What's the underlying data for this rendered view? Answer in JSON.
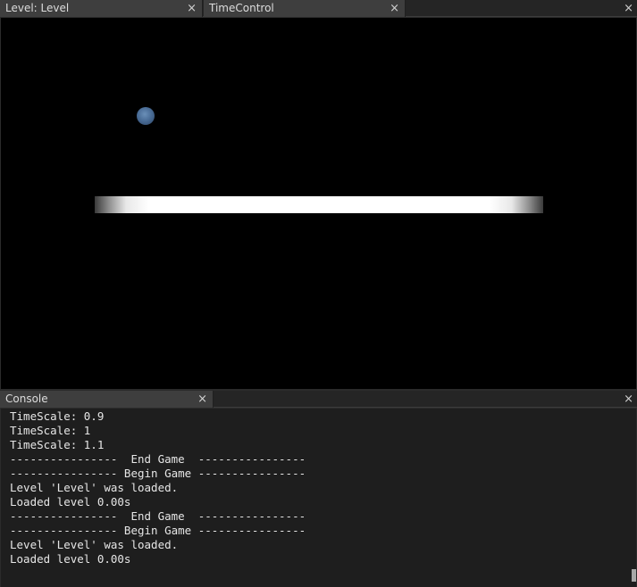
{
  "top_tabs": [
    {
      "label": "Level: Level",
      "close": "×"
    },
    {
      "label": "TimeControl",
      "close": "×"
    }
  ],
  "top_bar_close": "×",
  "console": {
    "tab_label": "Console",
    "tab_close": "×",
    "bar_close": "×",
    "lines": [
      "TimeScale: 0.9",
      "TimeScale: 1",
      "TimeScale: 1.1",
      "----------------  End Game  ----------------",
      "---------------- Begin Game ----------------",
      "Level 'Level' was loaded.",
      "Loaded level 0.00s",
      "----------------  End Game  ----------------",
      "---------------- Begin Game ----------------",
      "Level 'Level' was loaded.",
      "Loaded level 0.00s"
    ]
  },
  "colors": {
    "viewport_bg": "#000000",
    "ball": "#4a6d97",
    "platform": "#ffffff",
    "console_bg": "#1e1e1e",
    "tab_bg": "#3e3e3e"
  }
}
